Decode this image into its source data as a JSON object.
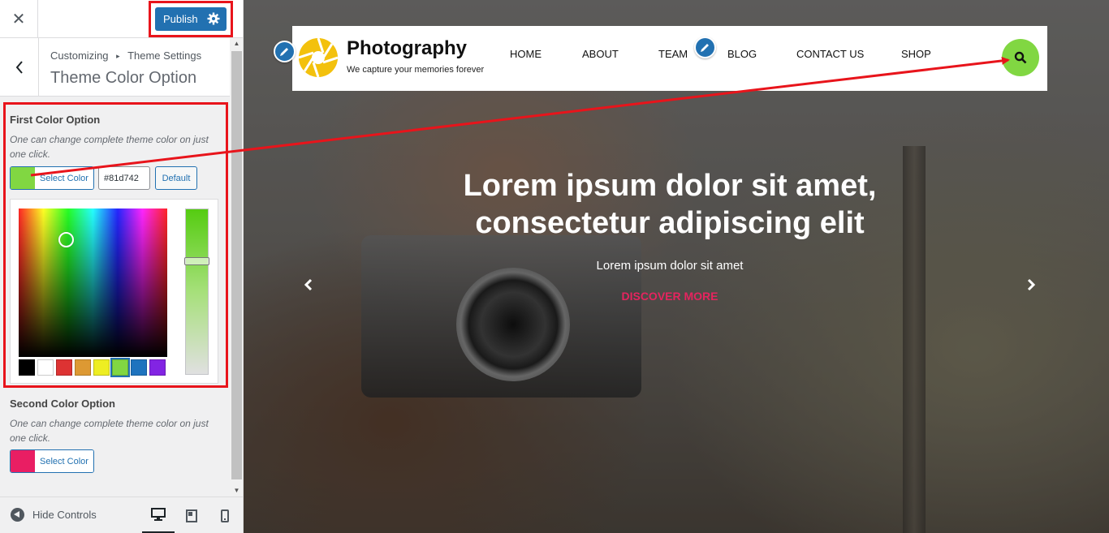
{
  "sidebar": {
    "close_label": "✕",
    "publish_label": "Publish",
    "breadcrumb_parent": "Customizing",
    "breadcrumb_separator": "▸",
    "breadcrumb_current": "Theme Settings",
    "section_title": "Theme Color Option",
    "first_color": {
      "title": "First Color Option",
      "description": "One can change complete theme color on just one click.",
      "select_label": "Select Color",
      "swatch_color": "#81d742",
      "hex_value": "#81d742",
      "default_label": "Default",
      "palette": [
        "#000000",
        "#ffffff",
        "#dd3333",
        "#dd9933",
        "#eeee22",
        "#81d742",
        "#1e73be",
        "#8224e3"
      ],
      "selected_palette_index": 5
    },
    "second_color": {
      "title": "Second Color Option",
      "description": "One can change complete theme color on just one click.",
      "select_label": "Select Color",
      "swatch_color": "#e91e63"
    },
    "footer": {
      "hide_controls_label": "Hide Controls"
    }
  },
  "preview": {
    "site_title": "Photography",
    "tagline": "We capture your memories forever",
    "nav": [
      "HOME",
      "ABOUT",
      "TEAM",
      "BLOG",
      "CONTACT US",
      "SHOP"
    ],
    "search_button_color": "#81d742",
    "hero_title": "Lorem ipsum dolor sit amet, consectetur adipiscing elit",
    "hero_subtitle": "Lorem ipsum dolor sit amet",
    "hero_cta": "DISCOVER MORE",
    "cta_color": "#e5245f"
  },
  "annotation_color": "#e8141b"
}
